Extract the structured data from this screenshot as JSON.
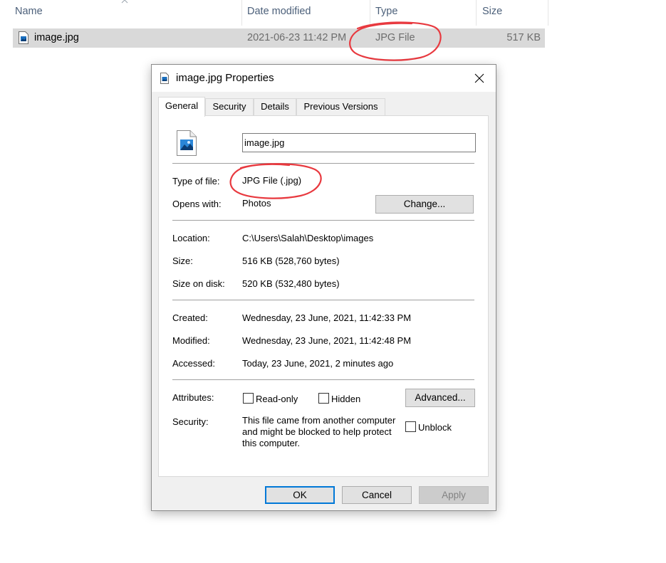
{
  "explorer": {
    "columns": {
      "name": "Name",
      "date_modified": "Date modified",
      "type": "Type",
      "size": "Size"
    },
    "row": {
      "name": "image.jpg",
      "date": "2021-06-23 11:42 PM",
      "type": "JPG File",
      "size": "517 KB"
    }
  },
  "dialog": {
    "title": "image.jpg Properties",
    "tabs": [
      "General",
      "Security",
      "Details",
      "Previous Versions"
    ],
    "filename": "image.jpg",
    "type_label": "Type of file:",
    "type_value": "JPG File (.jpg)",
    "opens_label": "Opens with:",
    "opens_value": "Photos",
    "change_button": "Change...",
    "location_label": "Location:",
    "location_value": "C:\\Users\\Salah\\Desktop\\images",
    "size_label": "Size:",
    "size_value": "516 KB (528,760 bytes)",
    "size_on_disk_label": "Size on disk:",
    "size_on_disk_value": "520 KB (532,480 bytes)",
    "created_label": "Created:",
    "created_value": "Wednesday, 23 June, 2021, 11:42:33 PM",
    "modified_label": "Modified:",
    "modified_value": "Wednesday, 23 June, 2021, 11:42:48 PM",
    "accessed_label": "Accessed:",
    "accessed_value": "Today, 23 June, 2021, 2 minutes ago",
    "attributes_label": "Attributes:",
    "readonly_label": "Read-only",
    "hidden_label": "Hidden",
    "advanced_button": "Advanced...",
    "security_label": "Security:",
    "security_text": "This file came from another computer and might be blocked to help protect this computer.",
    "unblock_label": "Unblock",
    "ok_button": "OK",
    "cancel_button": "Cancel",
    "apply_button": "Apply"
  },
  "colors": {
    "highlight_circle": "#e8393f",
    "accent": "#0078d7",
    "row_selected": "#d9d9d9"
  }
}
